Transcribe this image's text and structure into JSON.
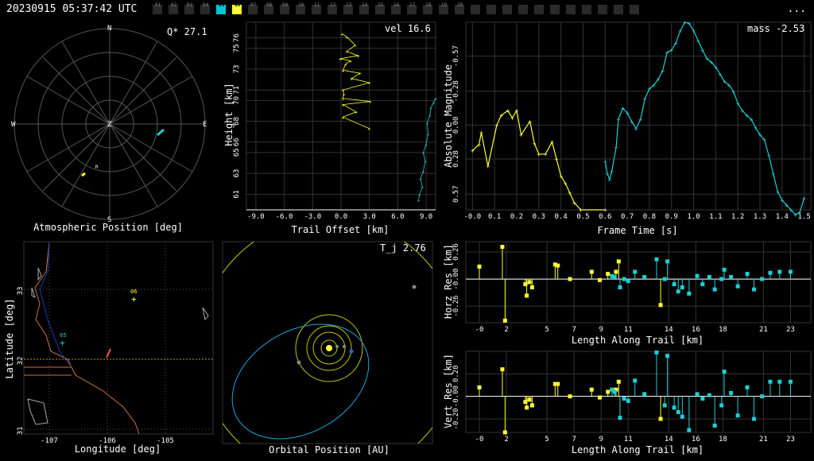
{
  "header": {
    "timestamp": "20230915 05:37:42 UTC",
    "menu_label": "...",
    "stations": [
      {
        "id": "01",
        "state": "off"
      },
      {
        "id": "02",
        "state": "off"
      },
      {
        "id": "03",
        "state": "off"
      },
      {
        "id": "04",
        "state": "off"
      },
      {
        "id": "05",
        "state": "cyan"
      },
      {
        "id": "06",
        "state": "yellow"
      },
      {
        "id": "07",
        "state": "off"
      },
      {
        "id": "08",
        "state": "off"
      },
      {
        "id": "09",
        "state": "off"
      },
      {
        "id": "10",
        "state": "off"
      },
      {
        "id": "11",
        "state": "off"
      },
      {
        "id": "12",
        "state": "off"
      },
      {
        "id": "13",
        "state": "off"
      },
      {
        "id": "14",
        "state": "off"
      },
      {
        "id": "15",
        "state": "off"
      },
      {
        "id": "16",
        "state": "off"
      },
      {
        "id": "17",
        "state": "off"
      },
      {
        "id": "18",
        "state": "off"
      },
      {
        "id": "19",
        "state": "off"
      },
      {
        "id": "20",
        "state": "off"
      },
      {
        "id": "",
        "state": "off"
      },
      {
        "id": "",
        "state": "off"
      },
      {
        "id": "",
        "state": "off"
      },
      {
        "id": "",
        "state": "off"
      },
      {
        "id": "",
        "state": "off"
      },
      {
        "id": "",
        "state": "off"
      },
      {
        "id": "",
        "state": "off"
      },
      {
        "id": "",
        "state": "off"
      },
      {
        "id": "",
        "state": "off"
      },
      {
        "id": "",
        "state": "off"
      },
      {
        "id": "",
        "state": "off"
      }
    ]
  },
  "colors": {
    "cyan": "#1ccfd6",
    "yellow": "#ffff33",
    "white": "#ffffff",
    "grid": "#444444"
  },
  "panels": {
    "sky": {
      "title": "Atmospheric Position [deg]",
      "q_label": "Q* 27.1",
      "compass": {
        "n": "N",
        "s": "S",
        "e": "E",
        "w": "W",
        "z": "Z",
        "r": "R"
      }
    },
    "height": {
      "xlabel": "Trail Offset [km]",
      "ylabel": "Height [km]",
      "vel_label": "vel 16.6",
      "xticks": [
        "-9.0",
        "-6.0",
        "-3.0",
        "0.0",
        "3.0",
        "6.0",
        "9.0"
      ],
      "yticks": [
        "61",
        "63",
        "65",
        "66",
        "68",
        "70",
        "71",
        "73",
        "75",
        "76"
      ]
    },
    "lightcurve": {
      "xlabel": "Frame Time [s]",
      "ylabel": "Absolute Magnitude",
      "mass_label": "mass -2.53",
      "xticks": [
        "-0.0",
        "0.1",
        "0.2",
        "0.3",
        "0.4",
        "0.5",
        "0.6",
        "0.7",
        "0.8",
        "0.9",
        "1.0",
        "1.1",
        "1.2",
        "1.3",
        "1.4",
        "1.5"
      ],
      "yticks": [
        "-0.57",
        "-0.28",
        "0.00",
        "0.28",
        "0.57"
      ]
    },
    "map": {
      "xlabel": "Longitude [deg]",
      "ylabel": "Latitude [deg]",
      "xticks": [
        "-107",
        "-106",
        "-105"
      ],
      "yticks": [
        "33",
        "32",
        "31"
      ],
      "stations": [
        "06",
        "05"
      ]
    },
    "orbit": {
      "xlabel": "Orbital Position [AU]",
      "tj_label": "T_j 2.76"
    },
    "horz": {
      "xlabel": "Length Along Trail [km]",
      "ylabel": "Horz Res [km]",
      "xticks": [
        "-0",
        "2",
        "5",
        "7",
        "9",
        "11",
        "14",
        "16",
        "18",
        "21",
        "23"
      ],
      "yticks": [
        "0.26",
        "-0.00",
        "-0.26"
      ]
    },
    "vert": {
      "xlabel": "Length Along Trail [km]",
      "ylabel": "Vert Res [km]",
      "xticks": [
        "-0",
        "2",
        "5",
        "7",
        "9",
        "11",
        "14",
        "16",
        "18",
        "21",
        "23"
      ],
      "yticks": [
        "0.20",
        "-0.00",
        "-0.20"
      ]
    }
  },
  "chart_data": [
    {
      "type": "scatter",
      "name": "height_vs_offset",
      "xlabel": "Trail Offset [km]",
      "ylabel": "Height [km]",
      "xlim": [
        -10,
        10
      ],
      "ylim": [
        59.5,
        77.5
      ],
      "series": [
        {
          "color": "yellow",
          "connect": true,
          "x": [
            0.1,
            0.6,
            1.5,
            0.6,
            1.8,
            -0.1,
            1.0,
            0.5,
            0.2,
            2.0,
            1.1,
            3.0,
            0.2,
            0.3,
            0.2,
            3.1,
            0.2,
            1.6,
            0.2,
            3.0
          ],
          "y": [
            76.4,
            76.1,
            75.3,
            74.7,
            74.3,
            74.0,
            73.8,
            73.5,
            72.9,
            72.6,
            72.1,
            71.7,
            71.0,
            70.6,
            70.2,
            69.9,
            69.6,
            68.9,
            68.4,
            67.3
          ]
        },
        {
          "color": "cyan",
          "connect": true,
          "x": [
            8.2,
            8.3,
            8.6,
            8.4,
            8.7,
            8.9,
            8.7,
            9.0,
            9.2,
            9.1,
            9.4,
            9.5,
            9.8,
            10.0
          ],
          "y": [
            60.4,
            61.0,
            61.7,
            62.5,
            63.2,
            64.2,
            65.0,
            65.8,
            66.8,
            67.8,
            68.6,
            69.3,
            69.8,
            70.2
          ]
        }
      ]
    },
    {
      "type": "line",
      "name": "light_curve",
      "xlabel": "Frame Time [s]",
      "ylabel": "Absolute Magnitude",
      "xlim": [
        -0.03,
        1.53
      ],
      "ylim": [
        0.7,
        -0.85
      ],
      "series": [
        {
          "color": "yellow",
          "x": [
            0.0,
            0.03,
            0.04,
            0.07,
            0.11,
            0.13,
            0.16,
            0.18,
            0.2,
            0.22,
            0.26,
            0.28,
            0.3,
            0.33,
            0.36,
            0.38,
            0.4,
            0.42,
            0.44,
            0.46,
            0.49,
            0.6
          ],
          "y": [
            0.21,
            0.16,
            0.06,
            0.34,
            0.0,
            -0.08,
            -0.12,
            -0.06,
            -0.12,
            0.08,
            -0.03,
            0.15,
            0.24,
            0.24,
            0.14,
            0.28,
            0.42,
            0.48,
            0.56,
            0.64,
            0.7,
            0.7
          ]
        },
        {
          "color": "cyan",
          "x": [
            0.6,
            0.61,
            0.62,
            0.63,
            0.65,
            0.66,
            0.68,
            0.7,
            0.72,
            0.74,
            0.76,
            0.78,
            0.8,
            0.82,
            0.84,
            0.86,
            0.88,
            0.9,
            0.92,
            0.94,
            0.96,
            0.98,
            1.0,
            1.02,
            1.04,
            1.06,
            1.08,
            1.1,
            1.12,
            1.14,
            1.16,
            1.18,
            1.2,
            1.22,
            1.24,
            1.26,
            1.28,
            1.3,
            1.32,
            1.34,
            1.36,
            1.38,
            1.4,
            1.42,
            1.44,
            1.46,
            1.48,
            1.5
          ],
          "y": [
            0.3,
            0.4,
            0.45,
            0.38,
            0.18,
            -0.05,
            -0.14,
            -0.1,
            -0.03,
            0.03,
            -0.05,
            -0.22,
            -0.3,
            -0.33,
            -0.38,
            -0.45,
            -0.6,
            -0.62,
            -0.68,
            -0.78,
            -0.85,
            -0.84,
            -0.78,
            -0.7,
            -0.62,
            -0.55,
            -0.52,
            -0.48,
            -0.42,
            -0.36,
            -0.33,
            -0.28,
            -0.18,
            -0.12,
            -0.08,
            -0.05,
            0.02,
            0.08,
            0.12,
            0.25,
            0.4,
            0.55,
            0.62,
            0.66,
            0.7,
            0.74,
            0.72,
            0.6
          ]
        }
      ]
    },
    {
      "type": "scatter",
      "name": "horizontal_residuals",
      "xlabel": "Length Along Trail [km]",
      "ylabel": "Horz Res [km]",
      "xlim": [
        -1,
        24.5
      ],
      "ylim": [
        -0.42,
        0.36
      ],
      "series": [
        {
          "color": "yellow",
          "x": [
            0.0,
            1.7,
            1.9,
            3.4,
            3.5,
            3.7,
            3.9,
            5.6,
            5.8,
            6.7,
            8.3,
            8.9,
            9.5,
            10.1,
            10.3,
            13.4
          ],
          "y": [
            0.12,
            0.31,
            -0.4,
            -0.05,
            -0.16,
            -0.03,
            -0.08,
            0.14,
            0.13,
            0.0,
            0.07,
            -0.01,
            0.05,
            0.07,
            0.17,
            -0.25
          ]
        },
        {
          "color": "cyan",
          "x": [
            9.8,
            10.0,
            10.4,
            10.7,
            11.0,
            11.5,
            12.2,
            13.1,
            13.7,
            13.9,
            14.4,
            14.7,
            15.0,
            15.5,
            16.1,
            16.5,
            17.0,
            17.4,
            17.9,
            18.1,
            18.6,
            19.1,
            19.8,
            20.3,
            20.9,
            21.5,
            22.2,
            23.0
          ],
          "y": [
            0.03,
            0.02,
            -0.08,
            0.0,
            -0.02,
            0.07,
            0.02,
            0.19,
            0.0,
            0.17,
            -0.05,
            -0.12,
            -0.08,
            -0.14,
            0.03,
            -0.05,
            0.02,
            -0.1,
            0.0,
            0.09,
            0.02,
            -0.07,
            0.05,
            -0.1,
            0.0,
            0.06,
            0.07,
            0.07
          ]
        }
      ]
    },
    {
      "type": "scatter",
      "name": "vertical_residuals",
      "xlabel": "Length Along Trail [km]",
      "ylabel": "Vert Res [km]",
      "xlim": [
        -1,
        24.5
      ],
      "ylim": [
        -0.32,
        0.4
      ],
      "series": [
        {
          "color": "yellow",
          "x": [
            0.0,
            1.7,
            1.9,
            3.4,
            3.5,
            3.7,
            3.9,
            5.6,
            5.8,
            6.7,
            8.3,
            8.9,
            9.5,
            10.1,
            10.3,
            13.4
          ],
          "y": [
            0.08,
            0.24,
            -0.32,
            -0.05,
            -0.1,
            -0.03,
            -0.08,
            0.11,
            0.11,
            0.0,
            0.06,
            -0.01,
            0.04,
            0.06,
            0.13,
            -0.2
          ]
        },
        {
          "color": "cyan",
          "x": [
            9.8,
            10.0,
            10.4,
            10.7,
            11.0,
            11.5,
            12.2,
            13.1,
            13.7,
            13.9,
            14.4,
            14.7,
            15.0,
            15.5,
            16.1,
            16.5,
            17.0,
            17.4,
            17.9,
            18.1,
            18.6,
            19.1,
            19.8,
            20.3,
            20.9,
            21.5,
            22.2,
            23.0
          ],
          "y": [
            0.06,
            0.04,
            -0.19,
            -0.02,
            -0.04,
            0.14,
            0.02,
            0.39,
            -0.08,
            0.36,
            -0.1,
            -0.14,
            -0.18,
            -0.3,
            0.02,
            -0.02,
            0.01,
            -0.26,
            -0.08,
            0.22,
            0.03,
            -0.17,
            0.08,
            -0.2,
            0.0,
            0.13,
            0.13,
            0.13
          ]
        }
      ]
    }
  ]
}
